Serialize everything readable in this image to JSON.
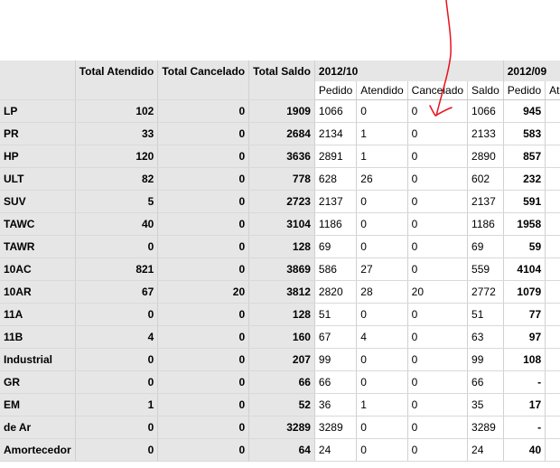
{
  "headers": {
    "total_atendido": "Total Atendido",
    "total_cancelado": "Total Cancelado",
    "total_saldo": "Total Saldo",
    "period_1": "2012/10",
    "period_2": "2012/09",
    "sub": [
      "Pedido",
      "Atendido",
      "Cancelado",
      "Saldo"
    ],
    "sub2": [
      "Pedido",
      "At"
    ]
  },
  "rows": [
    {
      "label": "LP",
      "ta": "102",
      "tc": "0",
      "ts": "1909",
      "p": "1066",
      "a": "0",
      "c": "0",
      "s": "1066",
      "p2": "945"
    },
    {
      "label": "PR",
      "ta": "33",
      "tc": "0",
      "ts": "2684",
      "p": "2134",
      "a": "1",
      "c": "0",
      "s": "2133",
      "p2": "583"
    },
    {
      "label": "HP",
      "ta": "120",
      "tc": "0",
      "ts": "3636",
      "p": "2891",
      "a": "1",
      "c": "0",
      "s": "2890",
      "p2": "857"
    },
    {
      "label": "ULT",
      "ta": "82",
      "tc": "0",
      "ts": "778",
      "p": "628",
      "a": "26",
      "c": "0",
      "s": "602",
      "p2": "232"
    },
    {
      "label": "SUV",
      "ta": "5",
      "tc": "0",
      "ts": "2723",
      "p": "2137",
      "a": "0",
      "c": "0",
      "s": "2137",
      "p2": "591"
    },
    {
      "label": "TAWC",
      "ta": "40",
      "tc": "0",
      "ts": "3104",
      "p": "1186",
      "a": "0",
      "c": "0",
      "s": "1186",
      "p2": "1958"
    },
    {
      "label": "TAWR",
      "ta": "0",
      "tc": "0",
      "ts": "128",
      "p": "69",
      "a": "0",
      "c": "0",
      "s": "69",
      "p2": "59"
    },
    {
      "label": "10AC",
      "ta": "821",
      "tc": "0",
      "ts": "3869",
      "p": "586",
      "a": "27",
      "c": "0",
      "s": "559",
      "p2": "4104"
    },
    {
      "label": "10AR",
      "ta": "67",
      "tc": "20",
      "ts": "3812",
      "p": "2820",
      "a": "28",
      "c": "20",
      "s": "2772",
      "p2": "1079"
    },
    {
      "label": "11A",
      "ta": "0",
      "tc": "0",
      "ts": "128",
      "p": "51",
      "a": "0",
      "c": "0",
      "s": "51",
      "p2": "77"
    },
    {
      "label": "11B",
      "ta": "4",
      "tc": "0",
      "ts": "160",
      "p": "67",
      "a": "4",
      "c": "0",
      "s": "63",
      "p2": "97"
    },
    {
      "label": "Industrial",
      "ta": "0",
      "tc": "0",
      "ts": "207",
      "p": "99",
      "a": "0",
      "c": "0",
      "s": "99",
      "p2": "108"
    },
    {
      "label": "GR",
      "ta": "0",
      "tc": "0",
      "ts": "66",
      "p": "66",
      "a": "0",
      "c": "0",
      "s": "66",
      "p2": "-"
    },
    {
      "label": "EM",
      "ta": "1",
      "tc": "0",
      "ts": "52",
      "p": "36",
      "a": "1",
      "c": "0",
      "s": "35",
      "p2": "17"
    },
    {
      "label": "de Ar",
      "ta": "0",
      "tc": "0",
      "ts": "3289",
      "p": "3289",
      "a": "0",
      "c": "0",
      "s": "3289",
      "p2": "-"
    },
    {
      "label": "Amortecedor",
      "ta": "0",
      "tc": "0",
      "ts": "64",
      "p": "24",
      "a": "0",
      "c": "0",
      "s": "24",
      "p2": "40"
    }
  ],
  "annotation_color": "#e8121c"
}
